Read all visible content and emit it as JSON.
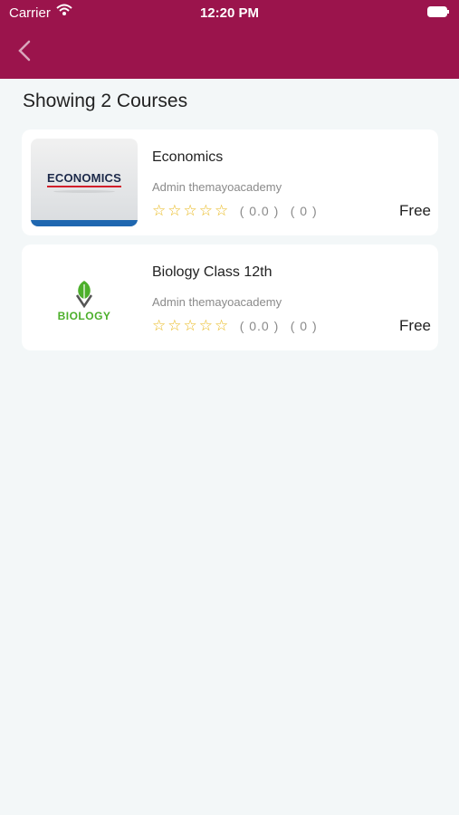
{
  "status_bar": {
    "carrier": "Carrier",
    "time": "12:20 PM"
  },
  "colors": {
    "header": "#9b144c",
    "background": "#f3f7f8",
    "star": "#e9b91f"
  },
  "header": {
    "back_icon": "chevron-left-icon"
  },
  "page": {
    "title": "Showing 2 Courses"
  },
  "courses": [
    {
      "thumbnail_text": "ECONOMICS",
      "title": "Economics",
      "author": "Admin themayoacademy",
      "stars": 0,
      "rating": "( 0.0 )",
      "reviews": "( 0 )",
      "price": "Free"
    },
    {
      "thumbnail_text": "BIOLOGY",
      "title": "Biology Class 12th",
      "author": "Admin themayoacademy",
      "stars": 0,
      "rating": "( 0.0 )",
      "reviews": "( 0 )",
      "price": "Free"
    }
  ]
}
